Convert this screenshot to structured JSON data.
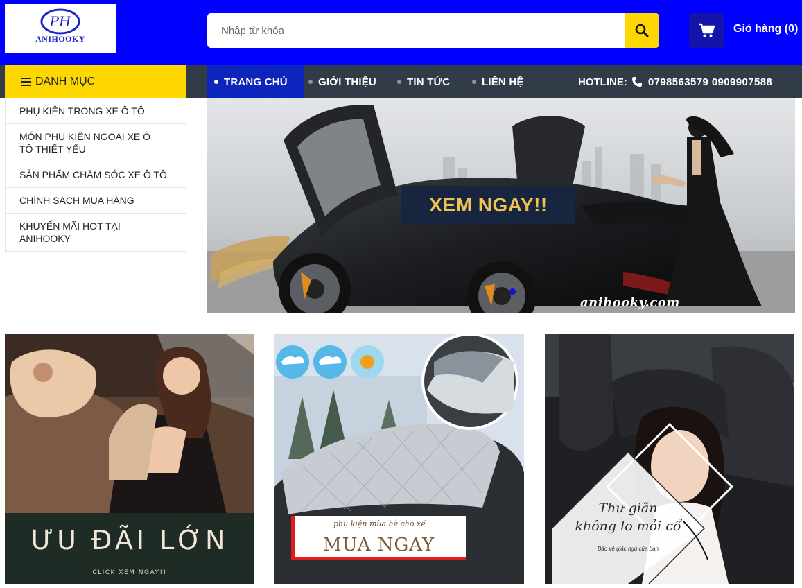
{
  "brand": {
    "logo_text": "ANIHOOKY"
  },
  "search": {
    "placeholder": "Nhập từ khóa",
    "button_icon": "search-icon"
  },
  "cart": {
    "label": "Giỏ hàng (0)",
    "icon": "cart-icon"
  },
  "nav": {
    "category_label": "DANH MỤC",
    "items": [
      {
        "label": "TRANG CHỦ",
        "active": true
      },
      {
        "label": "GIỚI THIỆU",
        "active": false
      },
      {
        "label": "TIN TỨC",
        "active": false
      },
      {
        "label": "LIÊN HỆ",
        "active": false
      }
    ],
    "hotline_label": "HOTLINE:",
    "hotline_numbers": "0798563579 0909907588"
  },
  "categories": [
    "PHỤ KIỆN TRONG XE Ô TÔ",
    "MÓN PHỤ KIỆN NGOÀI XE Ô TÔ THIẾT YẾU",
    "SẢN PHẨM CHĂM SÓC XE Ô TÔ",
    "CHÍNH SÁCH MUA HÀNG",
    "KHUYẾN MÃI HOT TẠI ANIHOOKY"
  ],
  "banner": {
    "cta": "XEM NGAY!!",
    "watermark": "anihooky.com"
  },
  "promos": [
    {
      "title": "ƯU ĐÃI LỚN",
      "subtitle": "CLICK XEM NGAY!!"
    },
    {
      "subtitle": "phụ kiện mùa hè cho xế",
      "title": "MUA NGAY"
    },
    {
      "line1": "Thư giãn",
      "line2": "không lo mỏi cổ",
      "line3": "Bảo vệ giấc ngủ của bạn"
    }
  ],
  "colors": {
    "header_bg": "#0000ff",
    "accent_yellow": "#fed700",
    "nav_bg": "#323b48",
    "active_nav": "#0d24bd"
  }
}
